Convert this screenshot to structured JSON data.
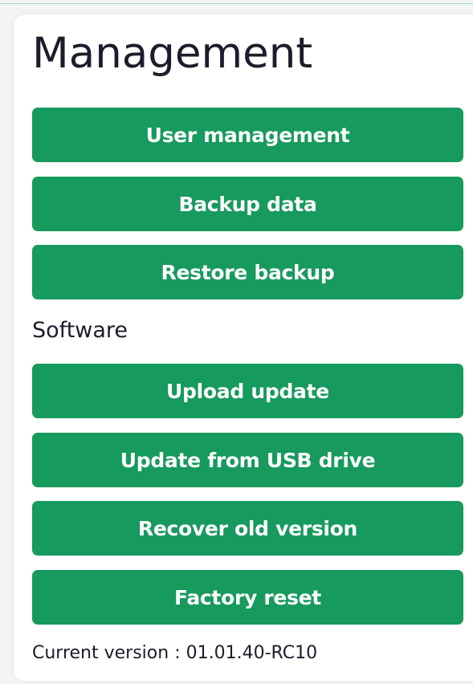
{
  "management": {
    "title": "Management",
    "buttons": [
      {
        "label": "User management"
      },
      {
        "label": "Backup data"
      },
      {
        "label": "Restore backup"
      }
    ]
  },
  "software": {
    "title": "Software",
    "buttons": [
      {
        "label": "Upload update"
      },
      {
        "label": "Update from USB drive"
      },
      {
        "label": "Recover old version"
      },
      {
        "label": "Factory reset"
      }
    ],
    "version_label": "Current version :",
    "version_value": "01.01.40-RC10"
  },
  "colors": {
    "button_bg": "#179a5d",
    "button_text": "#ffffff",
    "heading_text": "#1c1c2b"
  }
}
